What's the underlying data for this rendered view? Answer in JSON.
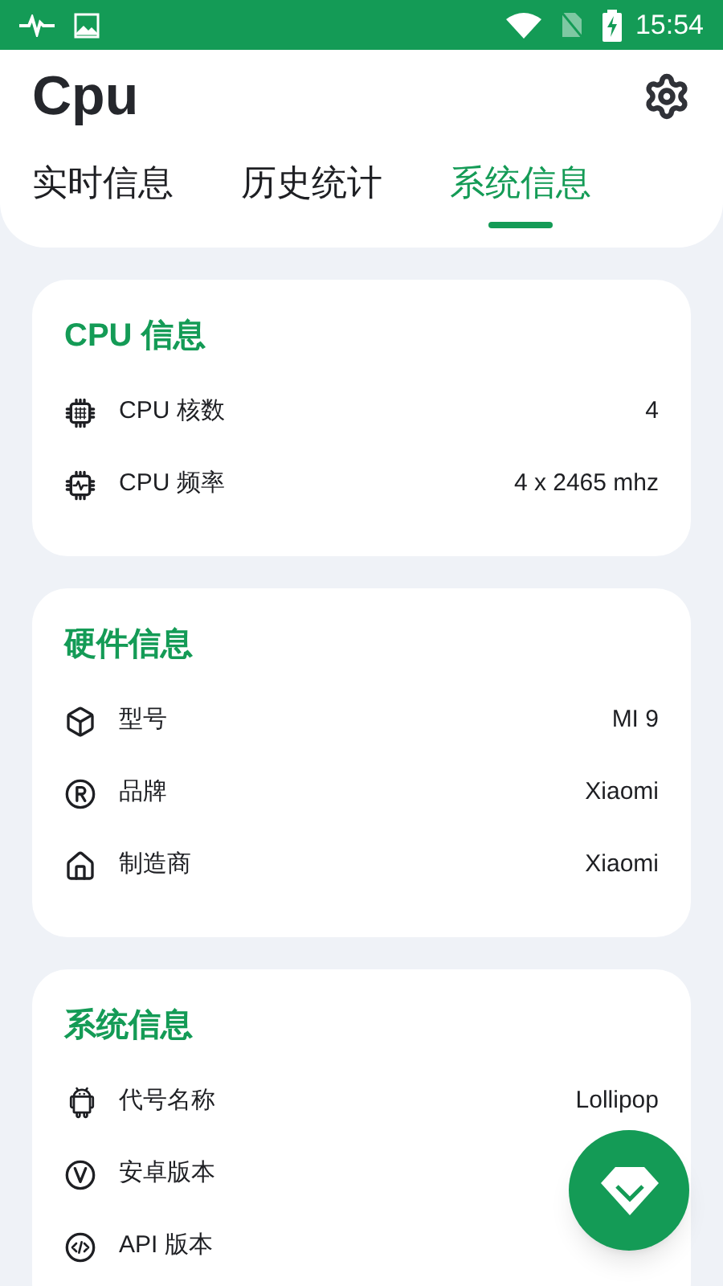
{
  "status_bar": {
    "time": "15:54"
  },
  "app_bar": {
    "title": "Cpu"
  },
  "tabs": [
    {
      "label": "实时信息",
      "selected": false
    },
    {
      "label": "历史统计",
      "selected": false
    },
    {
      "label": "系统信息",
      "selected": true
    }
  ],
  "sections": [
    {
      "title": "CPU 信息",
      "rows": [
        {
          "label": "CPU 核数",
          "value": "4"
        },
        {
          "label": "CPU 频率",
          "value": "4 x 2465 mhz"
        }
      ]
    },
    {
      "title": "硬件信息",
      "rows": [
        {
          "label": "型号",
          "value": "MI 9"
        },
        {
          "label": "品牌",
          "value": "Xiaomi"
        },
        {
          "label": "制造商",
          "value": "Xiaomi"
        }
      ]
    },
    {
      "title": "系统信息",
      "rows": [
        {
          "label": "代号名称",
          "value": "Lollipop"
        },
        {
          "label": "安卓版本"
        },
        {
          "label": "API 版本"
        }
      ]
    }
  ]
}
